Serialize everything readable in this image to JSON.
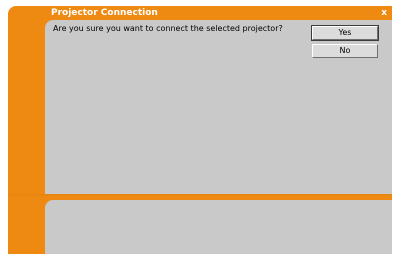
{
  "window": {
    "title": "Projector Connection",
    "close_label": "x"
  },
  "dialog": {
    "message": "Are you sure you want to connect the selected projector?",
    "yes_label": "Yes",
    "no_label": "No"
  },
  "colors": {
    "accent": "#ee8a12",
    "panel": "#c9c9c9"
  }
}
